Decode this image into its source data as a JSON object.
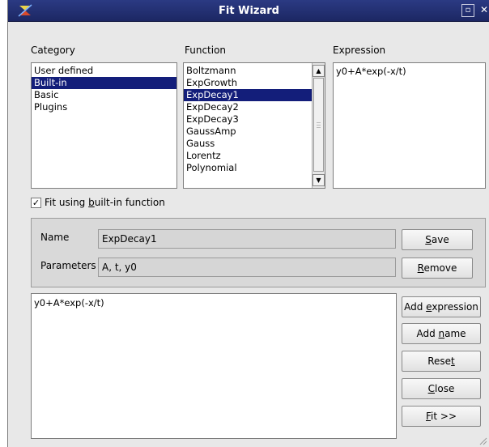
{
  "window": {
    "title": "Fit Wizard",
    "titlebar_color": "#1c2763"
  },
  "category": {
    "label": "Category",
    "items": [
      "User defined",
      "Built-in",
      "Basic",
      "Plugins"
    ],
    "selected": "Built-in"
  },
  "function": {
    "label": "Function",
    "items": [
      "Boltzmann",
      "ExpGrowth",
      "ExpDecay1",
      "ExpDecay2",
      "ExpDecay3",
      "GaussAmp",
      "Gauss",
      "Lorentz",
      "Polynomial"
    ],
    "selected": "ExpDecay1"
  },
  "expression": {
    "label": "Expression",
    "value": "y0+A*exp(-x/t)"
  },
  "fit_builtin": {
    "label_pre": "Fit using ",
    "label_ul": "b",
    "label_post": "uilt-in function",
    "checked": true
  },
  "params": {
    "name_label": "Name",
    "name_value": "ExpDecay1",
    "parameters_label": "Parameters",
    "parameters_value": "A, t, y0"
  },
  "buttons": {
    "save": {
      "ul": "S",
      "rest": "ave"
    },
    "remove": {
      "ul": "R",
      "rest": "emove"
    },
    "add_expression": {
      "pre": "Add ",
      "ul": "e",
      "rest": "xpression"
    },
    "add_name": {
      "pre": "Add ",
      "ul": "n",
      "rest": "ame"
    },
    "reset": {
      "pre": "Rese",
      "ul": "t",
      "rest": ""
    },
    "close": {
      "pre": "",
      "ul": "C",
      "rest": "lose"
    },
    "fit": {
      "pre": "",
      "ul": "F",
      "rest": "it >>"
    }
  },
  "editor": {
    "value": "y0+A*exp(-x/t)"
  },
  "selection_color": "#131e7a"
}
